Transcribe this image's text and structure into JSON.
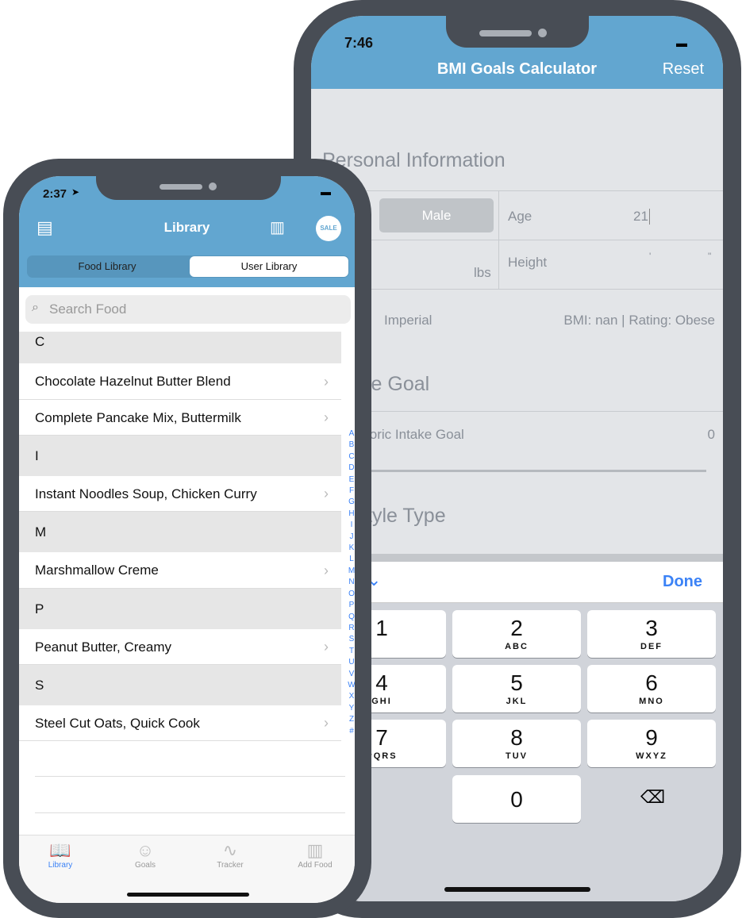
{
  "right_phone": {
    "status_time": "7:46",
    "title": "BMI Goals Calculator",
    "reset_label": "Reset",
    "section_personal": "Personal Information",
    "gender": "Male",
    "age_label": "Age",
    "age_value": "21",
    "weight_unit": "lbs",
    "height_label": "Height",
    "height_feet_mark": "'",
    "height_inch_mark": "\"",
    "unit_system": "Imperial",
    "bmi_text": "BMI: nan | Rating: Obese",
    "section_calorie": "ie Goal",
    "calorie_intake_label": "loric Intake Goal",
    "calorie_intake_value": "0",
    "section_lifestyle": "tyle Type",
    "done_label": "Done",
    "keys": [
      {
        "n": "1",
        "l": ""
      },
      {
        "n": "2",
        "l": "ABC"
      },
      {
        "n": "3",
        "l": "DEF"
      },
      {
        "n": "4",
        "l": "GHI"
      },
      {
        "n": "5",
        "l": "JKL"
      },
      {
        "n": "6",
        "l": "MNO"
      },
      {
        "n": "7",
        "l": "PQRS"
      },
      {
        "n": "8",
        "l": "TUV"
      },
      {
        "n": "9",
        "l": "WXYZ"
      },
      {
        "n": "0",
        "l": ""
      }
    ]
  },
  "left_phone": {
    "status_time": "2:37",
    "title": "Library",
    "sale_badge": "SALE",
    "segments": [
      "Food Library",
      "User Library"
    ],
    "search_placeholder": "Search Food",
    "sections": [
      {
        "letter": "C",
        "items": [
          "Chocolate Hazelnut Butter Blend",
          "Complete Pancake Mix, Buttermilk"
        ]
      },
      {
        "letter": "I",
        "items": [
          "Instant Noodles Soup, Chicken Curry"
        ]
      },
      {
        "letter": "M",
        "items": [
          "Marshmallow Creme"
        ]
      },
      {
        "letter": "P",
        "items": [
          "Peanut Butter, Creamy"
        ]
      },
      {
        "letter": "S",
        "items": [
          "Steel Cut Oats, Quick Cook"
        ]
      }
    ],
    "index": [
      "A",
      "B",
      "C",
      "D",
      "E",
      "F",
      "G",
      "H",
      "I",
      "J",
      "K",
      "L",
      "M",
      "N",
      "O",
      "P",
      "Q",
      "R",
      "S",
      "T",
      "U",
      "V",
      "W",
      "X",
      "Y",
      "Z",
      "#"
    ],
    "tabs": [
      {
        "label": "Library",
        "icon": "book-icon",
        "active": true
      },
      {
        "label": "Goals",
        "icon": "face-icon"
      },
      {
        "label": "Tracker",
        "icon": "chart-wave-icon"
      },
      {
        "label": "Add Food",
        "icon": "barcode-icon"
      }
    ]
  },
  "colors": {
    "header": "#62a6d0",
    "accent": "#3b82f6"
  }
}
